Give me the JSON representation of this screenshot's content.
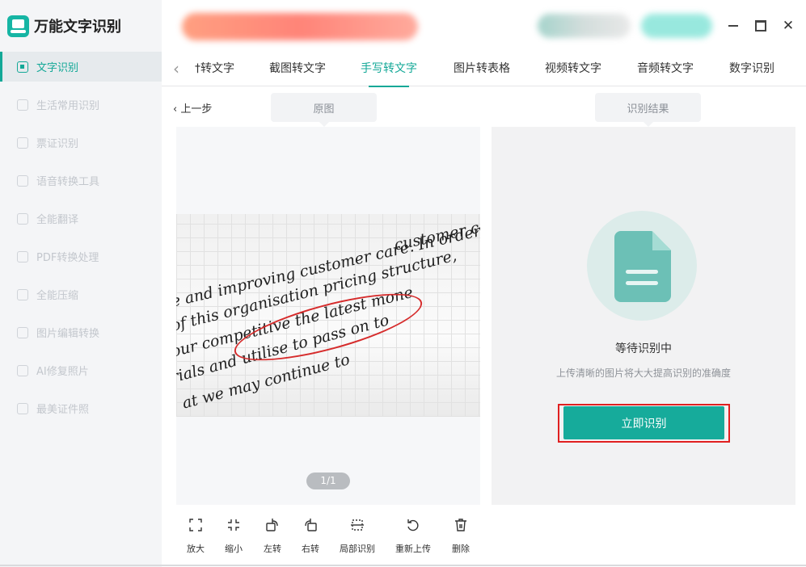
{
  "app": {
    "title": "万能文字识别"
  },
  "sidebar": {
    "items": [
      {
        "label": "文字识别",
        "icon": "text-scan-icon",
        "active": true
      },
      {
        "label": "生活常用识别",
        "icon": "scan-icon"
      },
      {
        "label": "票证识别",
        "icon": "ticket-icon"
      },
      {
        "label": "语音转换工具",
        "icon": "audio-icon"
      },
      {
        "label": "全能翻译",
        "icon": "translate-icon"
      },
      {
        "label": "PDF转换处理",
        "icon": "pdf-icon"
      },
      {
        "label": "全能压缩",
        "icon": "compress-icon"
      },
      {
        "label": "图片编辑转换",
        "icon": "image-edit-icon"
      },
      {
        "label": "AI修复照片",
        "icon": "ai-repair-icon"
      },
      {
        "label": "最美证件照",
        "icon": "id-photo-icon"
      }
    ]
  },
  "tabs": {
    "items": [
      "†转文字",
      "截图转文字",
      "手写转文字",
      "图片转表格",
      "视频转文字",
      "音频转文字",
      "数字识别"
    ],
    "active_index": 2
  },
  "toolbar": {
    "back_label": "上一步",
    "original_label": "原图",
    "result_label": "识别结果"
  },
  "preview": {
    "page_indicator": "1/1",
    "handwriting": [
      "customer care is ess",
      "e and improving customer care. In order to re",
      "of this organisation pricing structure,",
      "our competitive the latest mone",
      "rials and utilise to pass on to",
      "at we may continue to"
    ]
  },
  "tools": [
    {
      "label": "放大",
      "icon": "zoom-in-icon"
    },
    {
      "label": "缩小",
      "icon": "zoom-out-icon"
    },
    {
      "label": "左转",
      "icon": "rotate-left-icon"
    },
    {
      "label": "右转",
      "icon": "rotate-right-icon"
    },
    {
      "label": "局部识别",
      "icon": "crop-icon"
    },
    {
      "label": "重新上传",
      "icon": "reupload-icon"
    },
    {
      "label": "删除",
      "icon": "delete-icon"
    }
  ],
  "result": {
    "status_title": "等待识别中",
    "status_hint": "上传清晰的图片将大大提高识别的准确度",
    "recognize_label": "立即识别"
  },
  "colors": {
    "accent": "#13a897",
    "highlight_border": "#e02020"
  }
}
